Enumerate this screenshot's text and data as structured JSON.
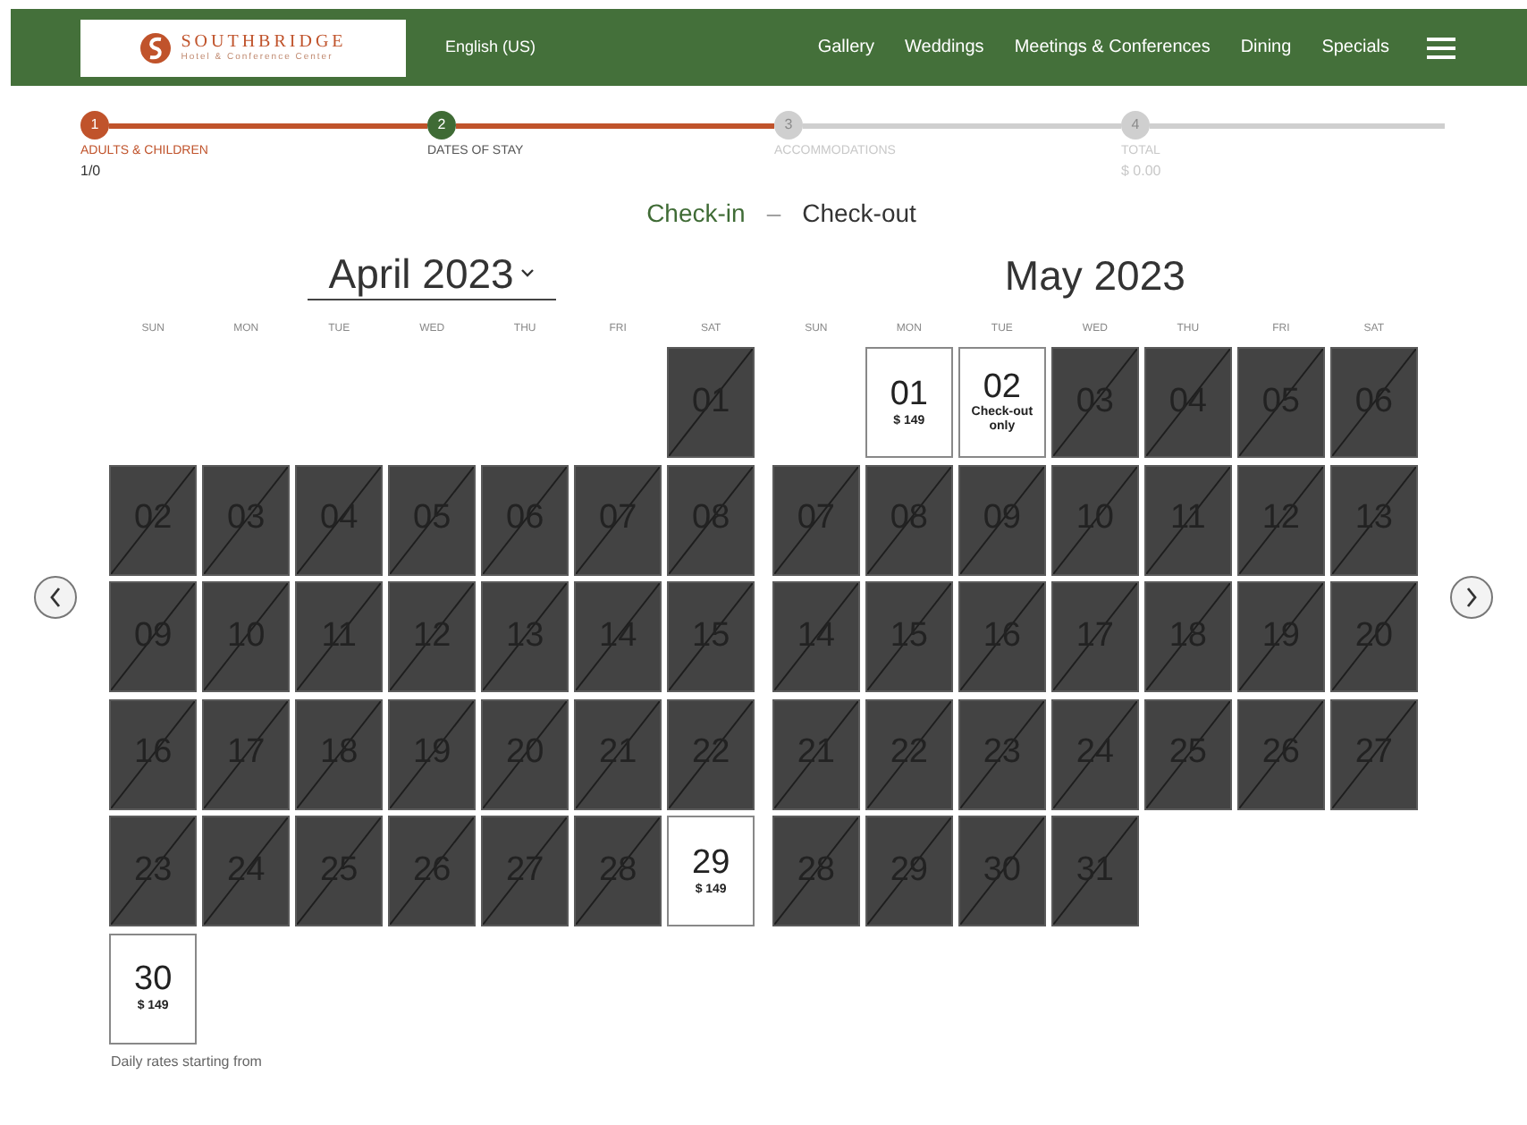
{
  "header": {
    "logo": {
      "name": "SOUTHBRIDGE",
      "tagline": "Hotel & Conference Center"
    },
    "language": "English (US)",
    "nav": [
      "Gallery",
      "Weddings",
      "Meetings & Conferences",
      "Dining",
      "Specials"
    ]
  },
  "steps": [
    {
      "number": "1",
      "label": "ADULTS & CHILDREN",
      "value": "1/0",
      "completed": true,
      "selected": false
    },
    {
      "number": "2",
      "label": "DATES OF STAY",
      "completed": false,
      "selected": true
    },
    {
      "number": "3",
      "label": "ACCOMMODATIONS",
      "completed": false,
      "selected": false
    },
    {
      "number": "4",
      "label": "TOTAL",
      "value": "$ 0.00",
      "completed": false,
      "selected": false
    }
  ],
  "range": {
    "check_in": "Check-in",
    "separator": "–",
    "check_out": "Check-out"
  },
  "months": [
    {
      "title": "April 2023",
      "dropdown": true,
      "weekdays": [
        "SUN",
        "MON",
        "TUE",
        "WED",
        "THU",
        "FRI",
        "SAT"
      ],
      "days": [
        {
          "kind": "blank"
        },
        {
          "kind": "blank"
        },
        {
          "kind": "blank"
        },
        {
          "kind": "blank"
        },
        {
          "kind": "blank"
        },
        {
          "kind": "blank"
        },
        {
          "kind": "day",
          "label": "01",
          "available": false
        },
        {
          "kind": "day",
          "label": "02",
          "available": false
        },
        {
          "kind": "day",
          "label": "03",
          "available": false
        },
        {
          "kind": "day",
          "label": "04",
          "available": false
        },
        {
          "kind": "day",
          "label": "05",
          "available": false
        },
        {
          "kind": "day",
          "label": "06",
          "available": false
        },
        {
          "kind": "day",
          "label": "07",
          "available": false
        },
        {
          "kind": "day",
          "label": "08",
          "available": false
        },
        {
          "kind": "day",
          "label": "09",
          "available": false
        },
        {
          "kind": "day",
          "label": "10",
          "available": false
        },
        {
          "kind": "day",
          "label": "11",
          "available": false
        },
        {
          "kind": "day",
          "label": "12",
          "available": false
        },
        {
          "kind": "day",
          "label": "13",
          "available": false
        },
        {
          "kind": "day",
          "label": "14",
          "available": false
        },
        {
          "kind": "day",
          "label": "15",
          "available": false
        },
        {
          "kind": "day",
          "label": "16",
          "available": false
        },
        {
          "kind": "day",
          "label": "17",
          "available": false
        },
        {
          "kind": "day",
          "label": "18",
          "available": false
        },
        {
          "kind": "day",
          "label": "19",
          "available": false
        },
        {
          "kind": "day",
          "label": "20",
          "available": false
        },
        {
          "kind": "day",
          "label": "21",
          "available": false
        },
        {
          "kind": "day",
          "label": "22",
          "available": false
        },
        {
          "kind": "day",
          "label": "23",
          "available": false
        },
        {
          "kind": "day",
          "label": "24",
          "available": false
        },
        {
          "kind": "day",
          "label": "25",
          "available": false
        },
        {
          "kind": "day",
          "label": "26",
          "available": false
        },
        {
          "kind": "day",
          "label": "27",
          "available": false
        },
        {
          "kind": "day",
          "label": "28",
          "available": false
        },
        {
          "kind": "day",
          "label": "29",
          "available": true,
          "price": "$ 149"
        },
        {
          "kind": "day",
          "label": "30",
          "available": true,
          "price": "$ 149"
        }
      ]
    },
    {
      "title": "May 2023",
      "dropdown": false,
      "weekdays": [
        "SUN",
        "MON",
        "TUE",
        "WED",
        "THU",
        "FRI",
        "SAT"
      ],
      "days": [
        {
          "kind": "blank"
        },
        {
          "kind": "day",
          "label": "01",
          "available": true,
          "price": "$ 149"
        },
        {
          "kind": "day",
          "label": "02",
          "available": true,
          "note": "Check-out only"
        },
        {
          "kind": "day",
          "label": "03",
          "available": false
        },
        {
          "kind": "day",
          "label": "04",
          "available": false
        },
        {
          "kind": "day",
          "label": "05",
          "available": false
        },
        {
          "kind": "day",
          "label": "06",
          "available": false
        },
        {
          "kind": "day",
          "label": "07",
          "available": false
        },
        {
          "kind": "day",
          "label": "08",
          "available": false
        },
        {
          "kind": "day",
          "label": "09",
          "available": false
        },
        {
          "kind": "day",
          "label": "10",
          "available": false
        },
        {
          "kind": "day",
          "label": "11",
          "available": false
        },
        {
          "kind": "day",
          "label": "12",
          "available": false
        },
        {
          "kind": "day",
          "label": "13",
          "available": false
        },
        {
          "kind": "day",
          "label": "14",
          "available": false
        },
        {
          "kind": "day",
          "label": "15",
          "available": false
        },
        {
          "kind": "day",
          "label": "16",
          "available": false
        },
        {
          "kind": "day",
          "label": "17",
          "available": false
        },
        {
          "kind": "day",
          "label": "18",
          "available": false
        },
        {
          "kind": "day",
          "label": "19",
          "available": false
        },
        {
          "kind": "day",
          "label": "20",
          "available": false
        },
        {
          "kind": "day",
          "label": "21",
          "available": false
        },
        {
          "kind": "day",
          "label": "22",
          "available": false
        },
        {
          "kind": "day",
          "label": "23",
          "available": false
        },
        {
          "kind": "day",
          "label": "24",
          "available": false
        },
        {
          "kind": "day",
          "label": "25",
          "available": false
        },
        {
          "kind": "day",
          "label": "26",
          "available": false
        },
        {
          "kind": "day",
          "label": "27",
          "available": false
        },
        {
          "kind": "day",
          "label": "28",
          "available": false
        },
        {
          "kind": "day",
          "label": "29",
          "available": false
        },
        {
          "kind": "day",
          "label": "30",
          "available": false
        },
        {
          "kind": "day",
          "label": "31",
          "available": false
        }
      ]
    }
  ],
  "footnote": "Daily rates starting from"
}
